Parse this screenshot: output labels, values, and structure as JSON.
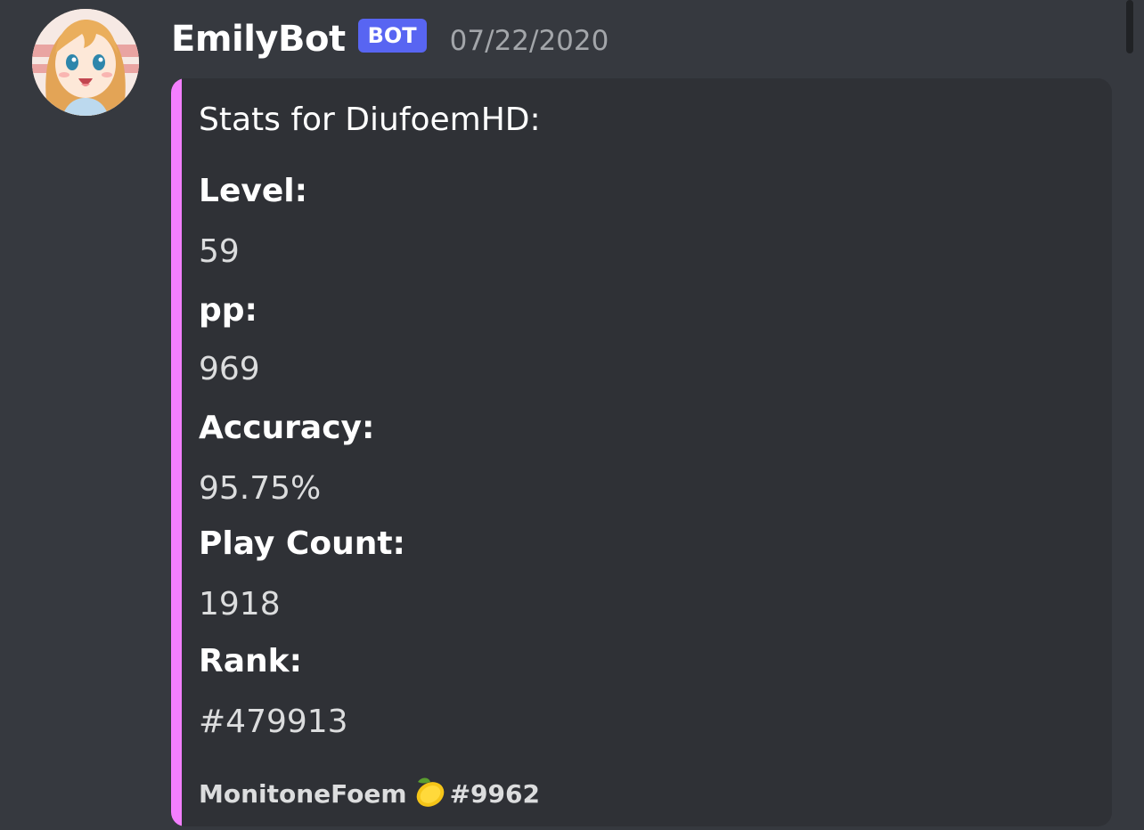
{
  "message": {
    "username": "EmilyBot",
    "badge": "BOT",
    "timestamp": "07/22/2020",
    "avatar_icon": "anime-avatar-icon"
  },
  "embed": {
    "accent_color": "#f47fff",
    "title": "Stats for DiufoemHD:",
    "fields": [
      {
        "name": "Level:",
        "value": "59"
      },
      {
        "name": "pp:",
        "value": "969"
      },
      {
        "name": "Accuracy:",
        "value": "95.75%"
      },
      {
        "name": "Play Count:",
        "value": "1918"
      },
      {
        "name": "Rank:",
        "value": "#479913"
      }
    ],
    "footer": {
      "name": "MonitoneFoem",
      "emoji_icon": "lemon-icon",
      "discriminator": "#9962"
    }
  },
  "colors": {
    "background": "#36393f",
    "embed_background": "#2f3136",
    "badge": "#5865f2"
  }
}
